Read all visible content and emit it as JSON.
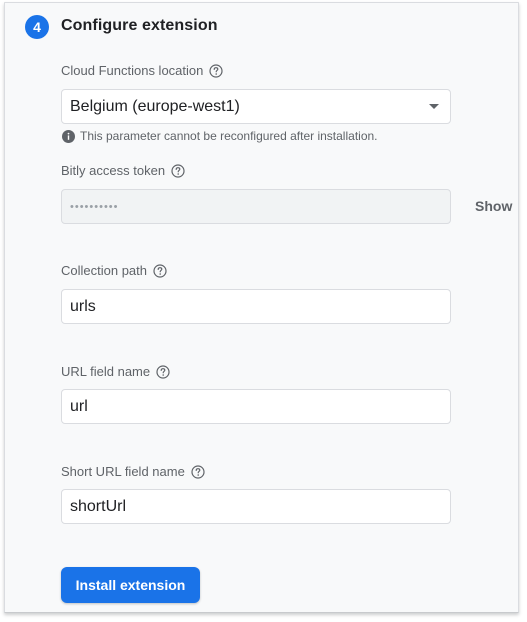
{
  "step": {
    "number": "4",
    "title": "Configure extension"
  },
  "fields": {
    "location": {
      "label": "Cloud Functions location",
      "value": "Belgium (europe-west1)",
      "note": "This parameter cannot be reconfigured after installation."
    },
    "bitly_token": {
      "label": "Bitly access token",
      "value": "••••••••••",
      "show_label": "Show"
    },
    "collection_path": {
      "label": "Collection path",
      "value": "urls"
    },
    "url_field": {
      "label": "URL field name",
      "value": "url"
    },
    "short_url_field": {
      "label": "Short URL field name",
      "value": "shortUrl"
    }
  },
  "actions": {
    "install_label": "Install extension"
  },
  "icons": {
    "help": "help-circle-icon",
    "info": "info-icon",
    "dropdown": "dropdown-arrow-icon"
  },
  "colors": {
    "accent": "#1a73e8",
    "panel_bg": "#f8f9fa",
    "label_text": "#5f6368"
  }
}
